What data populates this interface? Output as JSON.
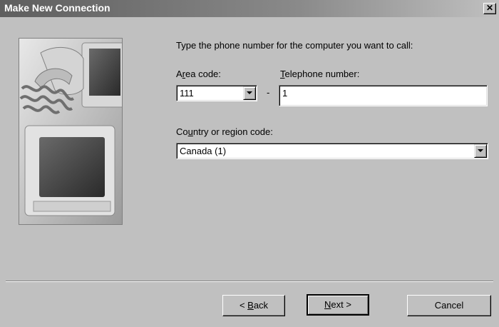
{
  "window": {
    "title": "Make New Connection",
    "close_glyph": "✕"
  },
  "prompt": "Type the phone number for the computer you want to call:",
  "area_code": {
    "label_pre": "A",
    "label_u": "r",
    "label_post": "ea code:",
    "value": "111"
  },
  "dash": "-",
  "telephone": {
    "label_pre": "",
    "label_u": "T",
    "label_post": "elephone number:",
    "value": "1"
  },
  "country": {
    "label_pre": "Co",
    "label_u": "u",
    "label_post": "ntry or region code:",
    "value": "Canada (1)"
  },
  "buttons": {
    "back_pre": "< ",
    "back_u": "B",
    "back_post": "ack",
    "next_u": "N",
    "next_post": "ext >",
    "cancel": "Cancel"
  },
  "colors": {
    "dialog_bg": "#c0c0c0",
    "titlebar_start": "#5e5e5e"
  },
  "icons": {
    "illustration": "computer-and-telephone-illustration",
    "close": "close-icon",
    "dropdown": "chevron-down-icon"
  }
}
